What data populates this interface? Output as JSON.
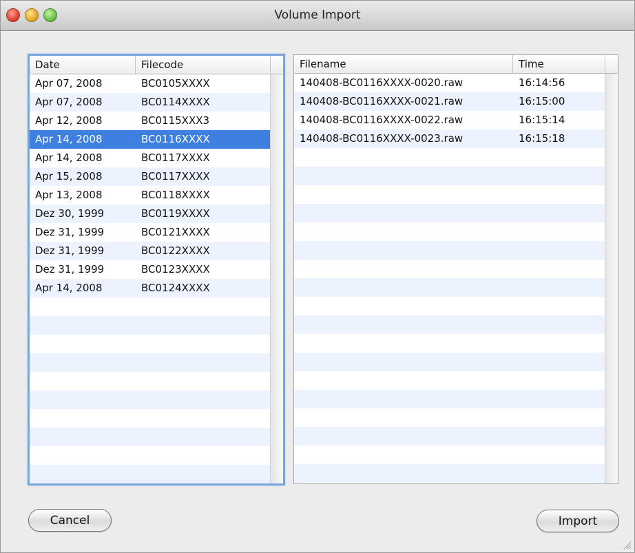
{
  "window": {
    "title": "Volume Import"
  },
  "left_table": {
    "columns": [
      "Date",
      "Filecode"
    ],
    "selected_index": 3,
    "rows": [
      [
        "Apr 07, 2008",
        "BC0105XXXX"
      ],
      [
        "Apr 07, 2008",
        "BC0114XXXX"
      ],
      [
        "Apr 12, 2008",
        "BC0115XXX3"
      ],
      [
        "Apr 14, 2008",
        "BC0116XXXX"
      ],
      [
        "Apr 14, 2008",
        "BC0117XXXX"
      ],
      [
        "Apr 15, 2008",
        "BC0117XXXX"
      ],
      [
        "Apr 13, 2008",
        "BC0118XXXX"
      ],
      [
        "Dez 30, 1999",
        "BC0119XXXX"
      ],
      [
        "Dez 31, 1999",
        "BC0121XXXX"
      ],
      [
        "Dez 31, 1999",
        "BC0122XXXX"
      ],
      [
        "Dez 31, 1999",
        "BC0123XXXX"
      ],
      [
        "Apr 14, 2008",
        "BC0124XXXX"
      ]
    ]
  },
  "right_table": {
    "columns": [
      "Filename",
      "Time"
    ],
    "rows": [
      [
        "140408-BC0116XXXX-0020.raw",
        "16:14:56"
      ],
      [
        "140408-BC0116XXXX-0021.raw",
        "16:15:00"
      ],
      [
        "140408-BC0116XXXX-0022.raw",
        "16:15:14"
      ],
      [
        "140408-BC0116XXXX-0023.raw",
        "16:15:18"
      ]
    ]
  },
  "buttons": {
    "cancel": "Cancel",
    "import": "Import"
  },
  "colors": {
    "selection": "#3d80df",
    "stripe": "#edf3fe",
    "focus_ring": "#7aa6dd"
  }
}
